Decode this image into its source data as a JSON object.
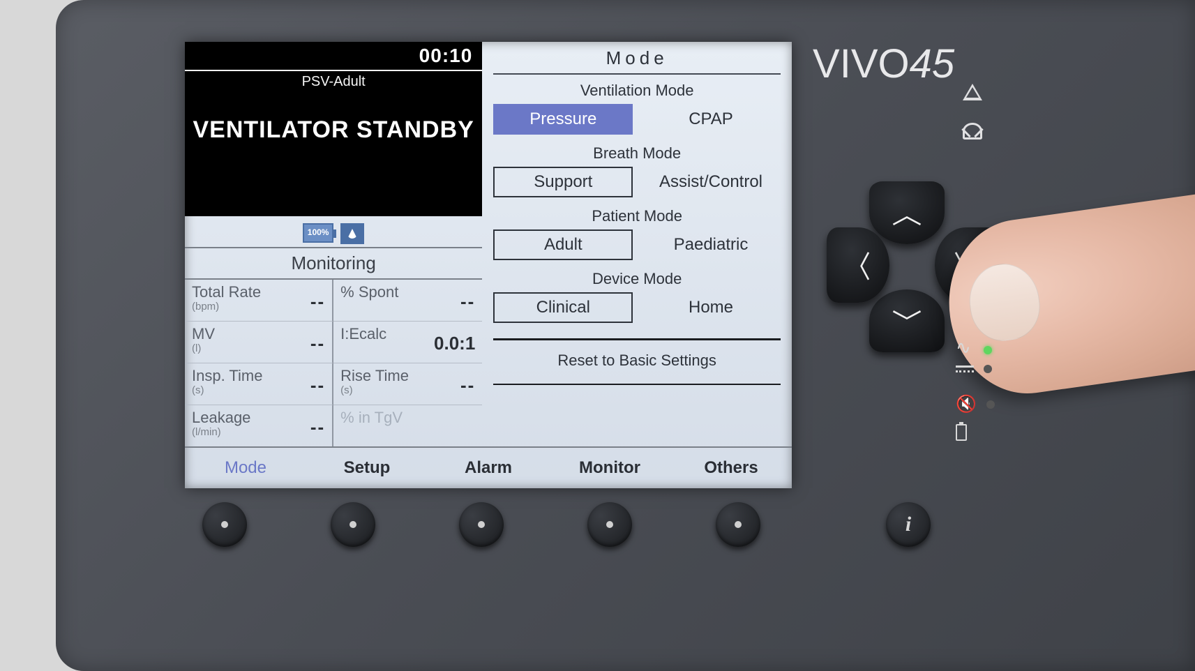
{
  "brand": "VIVO45",
  "header": {
    "time": "00:10",
    "mode_short": "PSV-Adult",
    "status": "VENTILATOR STANDBY",
    "battery_pct": "100%"
  },
  "monitoring": {
    "title": "Monitoring",
    "rows": [
      {
        "l_label": "Total Rate",
        "l_unit": "(bpm)",
        "l_val": "--",
        "r_label": "% Spont",
        "r_unit": "",
        "r_val": "--"
      },
      {
        "l_label": "MV",
        "l_unit": "(l)",
        "l_val": "--",
        "r_label": "I:Ecalc",
        "r_unit": "",
        "r_val": "0.0:1"
      },
      {
        "l_label": "Insp. Time",
        "l_unit": "(s)",
        "l_val": "--",
        "r_label": "Rise Time",
        "r_unit": "(s)",
        "r_val": "--"
      },
      {
        "l_label": "Leakage",
        "l_unit": "(l/min)",
        "l_val": "--",
        "r_label": "% in TgV",
        "r_unit": "",
        "r_val": ""
      }
    ]
  },
  "mode_panel": {
    "title": "Mode",
    "sections": {
      "ventilation": {
        "label": "Ventilation Mode",
        "opt1": "Pressure",
        "opt2": "CPAP",
        "selected": 1
      },
      "breath": {
        "label": "Breath Mode",
        "opt1": "Support",
        "opt2": "Assist/Control",
        "selected": 1
      },
      "patient": {
        "label": "Patient Mode",
        "opt1": "Adult",
        "opt2": "Paediatric",
        "selected": 1
      },
      "device": {
        "label": "Device Mode",
        "opt1": "Clinical",
        "opt2": "Home",
        "selected": 1
      }
    },
    "reset": "Reset to Basic Settings"
  },
  "tabs": {
    "items": [
      "Mode",
      "Setup",
      "Alarm",
      "Monitor",
      "Others"
    ],
    "active": 0
  }
}
